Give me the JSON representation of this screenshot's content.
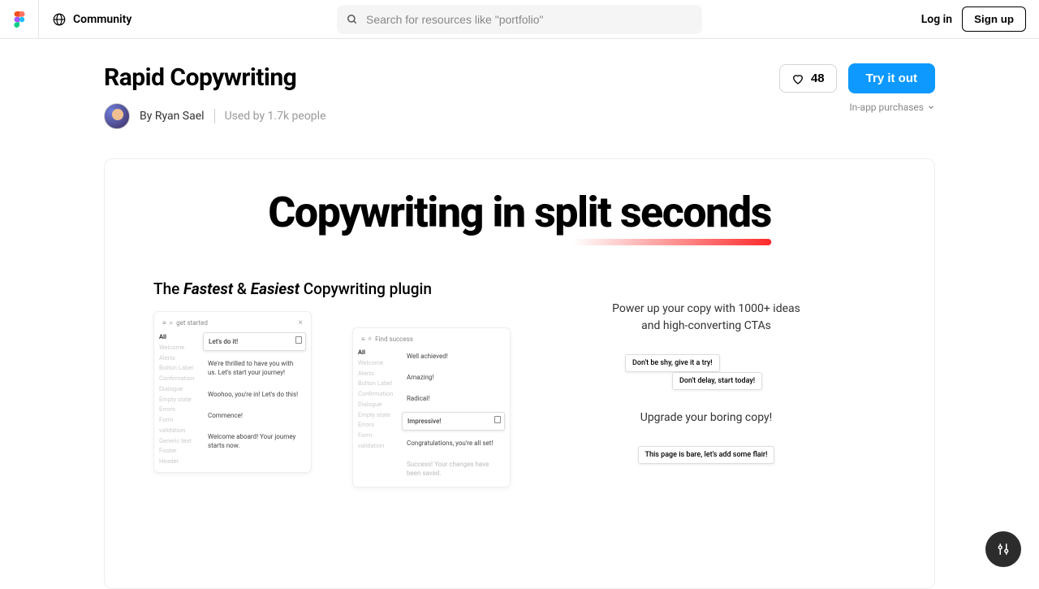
{
  "header": {
    "community_label": "Community",
    "search_placeholder": "Search for resources like \"portfolio\"",
    "login_label": "Log in",
    "signup_label": "Sign up"
  },
  "page": {
    "title": "Rapid Copywriting",
    "author_prefix": "By ",
    "author": "Ryan Sael",
    "usage": "Used by 1.7k people",
    "like_count": "48",
    "try_label": "Try it out",
    "iap_label": "In-app purchases"
  },
  "hero": {
    "headline": "Copywriting in split seconds",
    "sub_prefix": "The ",
    "sub_w1": "Fastest",
    "sub_amp": " & ",
    "sub_w2": "Easiest",
    "sub_suffix": " Copywriting plugin",
    "right1": "Power up your copy with 1000+ ideas and high-converting CTAs",
    "chip1": "Don't be shy, give it a try!",
    "chip2": "Don't delay, start today!",
    "right2": "Upgrade your boring copy!",
    "chip3": "This page is bare, let's add some flair!"
  },
  "mock1": {
    "search": "get started",
    "side": [
      "All",
      "Welcome",
      "",
      "Alerts",
      "Button Label",
      "Confirmation",
      "Dialogue",
      "Empty state",
      "Errors",
      "Form validation",
      "Generic text",
      "Footer",
      "Header"
    ],
    "items": [
      {
        "text": "Let's do it!",
        "highlight": true
      },
      {
        "text": "We're thrilled to have you with us. Let's start your journey!"
      },
      {
        "text": "Woohoo, you're in! Let's do this!"
      },
      {
        "text": "Commence!"
      },
      {
        "text": "Welcome aboard! Your journey starts now."
      }
    ]
  },
  "mock2": {
    "search": "Find success",
    "side": [
      "All",
      "Welcome",
      "",
      "Alerts",
      "Button Label",
      "Confirmation",
      "Dialogue",
      "Empty state",
      "Errors",
      "Form validation"
    ],
    "items": [
      {
        "text": "Well achieved!"
      },
      {
        "text": "Amazing!"
      },
      {
        "text": "Radical!"
      },
      {
        "text": "Impressive!",
        "highlight": true
      },
      {
        "text": "Congratulations, you're all set!"
      },
      {
        "text": "Success! Your changes have been saved.",
        "faded": true
      }
    ]
  }
}
